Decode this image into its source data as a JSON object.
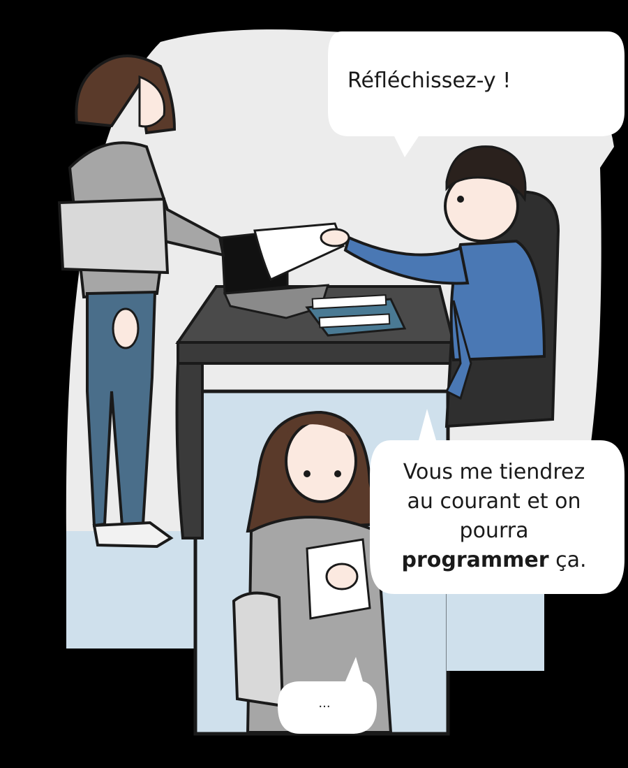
{
  "speech": {
    "bubble_top": "Réfléchissez-y !",
    "bubble_right": {
      "line1": "Vous me tiendrez",
      "line2": "au courant et on",
      "line3": "pourra",
      "line4_bold": "programmer",
      "line4_rest": " ça."
    },
    "bubble_bottom": "..."
  }
}
